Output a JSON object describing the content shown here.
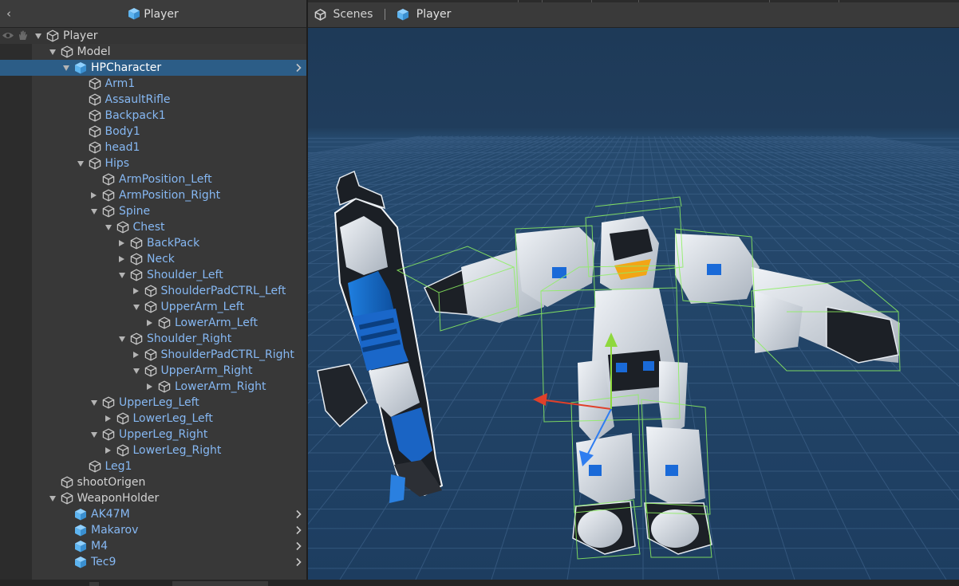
{
  "hierarchy": {
    "back_glyph": "‹",
    "title": "Player",
    "rows": [
      {
        "label": "Player",
        "kind": "plain",
        "depth": 0,
        "fold": "open",
        "icon": "cube-outline-icon"
      },
      {
        "label": "Model",
        "kind": "plain",
        "depth": 1,
        "fold": "open",
        "icon": "cube-outline-icon"
      },
      {
        "label": "HPCharacter",
        "kind": "prefab",
        "depth": 2,
        "fold": "open",
        "icon": "prefab-cube-icon",
        "selected": true,
        "openable": true
      },
      {
        "label": "Arm1",
        "kind": "prefab",
        "depth": 3,
        "fold": "none",
        "icon": "cube-outline-icon"
      },
      {
        "label": "AssaultRifle",
        "kind": "prefab",
        "depth": 3,
        "fold": "none",
        "icon": "cube-outline-icon"
      },
      {
        "label": "Backpack1",
        "kind": "prefab",
        "depth": 3,
        "fold": "none",
        "icon": "cube-outline-icon"
      },
      {
        "label": "Body1",
        "kind": "prefab",
        "depth": 3,
        "fold": "none",
        "icon": "cube-outline-icon"
      },
      {
        "label": "head1",
        "kind": "prefab",
        "depth": 3,
        "fold": "none",
        "icon": "cube-outline-icon"
      },
      {
        "label": "Hips",
        "kind": "prefab",
        "depth": 3,
        "fold": "open",
        "icon": "cube-outline-icon"
      },
      {
        "label": "ArmPosition_Left",
        "kind": "prefab",
        "depth": 4,
        "fold": "none",
        "icon": "cube-outline-icon"
      },
      {
        "label": "ArmPosition_Right",
        "kind": "prefab",
        "depth": 4,
        "fold": "closed",
        "icon": "cube-outline-icon"
      },
      {
        "label": "Spine",
        "kind": "prefab",
        "depth": 4,
        "fold": "open",
        "icon": "cube-outline-icon"
      },
      {
        "label": "Chest",
        "kind": "prefab",
        "depth": 5,
        "fold": "open",
        "icon": "cube-outline-icon"
      },
      {
        "label": "BackPack",
        "kind": "prefab",
        "depth": 6,
        "fold": "closed",
        "icon": "cube-outline-icon"
      },
      {
        "label": "Neck",
        "kind": "prefab",
        "depth": 6,
        "fold": "closed",
        "icon": "cube-outline-icon"
      },
      {
        "label": "Shoulder_Left",
        "kind": "prefab",
        "depth": 6,
        "fold": "open",
        "icon": "cube-outline-icon"
      },
      {
        "label": "ShoulderPadCTRL_Left",
        "kind": "prefab",
        "depth": 7,
        "fold": "closed",
        "icon": "cube-outline-icon"
      },
      {
        "label": "UpperArm_Left",
        "kind": "prefab",
        "depth": 7,
        "fold": "open",
        "icon": "cube-outline-icon"
      },
      {
        "label": "LowerArm_Left",
        "kind": "prefab",
        "depth": 8,
        "fold": "closed",
        "icon": "cube-outline-icon"
      },
      {
        "label": "Shoulder_Right",
        "kind": "prefab",
        "depth": 6,
        "fold": "open",
        "icon": "cube-outline-icon"
      },
      {
        "label": "ShoulderPadCTRL_Right",
        "kind": "prefab",
        "depth": 7,
        "fold": "closed",
        "icon": "cube-outline-icon"
      },
      {
        "label": "UpperArm_Right",
        "kind": "prefab",
        "depth": 7,
        "fold": "open",
        "icon": "cube-outline-icon"
      },
      {
        "label": "LowerArm_Right",
        "kind": "prefab",
        "depth": 8,
        "fold": "closed",
        "icon": "cube-outline-icon"
      },
      {
        "label": "UpperLeg_Left",
        "kind": "prefab",
        "depth": 4,
        "fold": "open",
        "icon": "cube-outline-icon"
      },
      {
        "label": "LowerLeg_Left",
        "kind": "prefab",
        "depth": 5,
        "fold": "closed",
        "icon": "cube-outline-icon"
      },
      {
        "label": "UpperLeg_Right",
        "kind": "prefab",
        "depth": 4,
        "fold": "open",
        "icon": "cube-outline-icon"
      },
      {
        "label": "LowerLeg_Right",
        "kind": "prefab",
        "depth": 5,
        "fold": "closed",
        "icon": "cube-outline-icon"
      },
      {
        "label": "Leg1",
        "kind": "prefab",
        "depth": 3,
        "fold": "none",
        "icon": "cube-outline-icon"
      },
      {
        "label": "shootOrigen",
        "kind": "plain",
        "depth": 1,
        "fold": "none",
        "icon": "cube-outline-icon"
      },
      {
        "label": "WeaponHolder",
        "kind": "plain",
        "depth": 1,
        "fold": "open",
        "icon": "cube-outline-icon"
      },
      {
        "label": "AK47M",
        "kind": "prefab",
        "depth": 2,
        "fold": "none",
        "icon": "prefab-cube-icon",
        "openable": true
      },
      {
        "label": "Makarov",
        "kind": "prefab",
        "depth": 2,
        "fold": "none",
        "icon": "prefab-cube-icon",
        "openable": true
      },
      {
        "label": "M4",
        "kind": "prefab",
        "depth": 2,
        "fold": "none",
        "icon": "prefab-cube-icon",
        "openable": true
      },
      {
        "label": "Tec9",
        "kind": "prefab",
        "depth": 2,
        "fold": "none",
        "icon": "prefab-cube-icon",
        "openable": true
      }
    ]
  },
  "scene": {
    "breadcrumb": {
      "scenes_label": "Scenes",
      "prefab_label": "Player"
    },
    "icons": [
      "unity-scenes-icon",
      "prefab-cube-icon"
    ]
  },
  "colors": {
    "panel_bg": "#383838",
    "selection": "#2c5d87",
    "prefab_text": "#86b8f3",
    "prefab_icon": "#5db4f0",
    "scene_bg": "#1f3a56",
    "grid_line": "#3b5f86",
    "bone_box": "#8cf060",
    "gizmo_x": "#e0402a",
    "gizmo_y": "#8ed83e",
    "gizmo_z": "#2f7df0"
  }
}
